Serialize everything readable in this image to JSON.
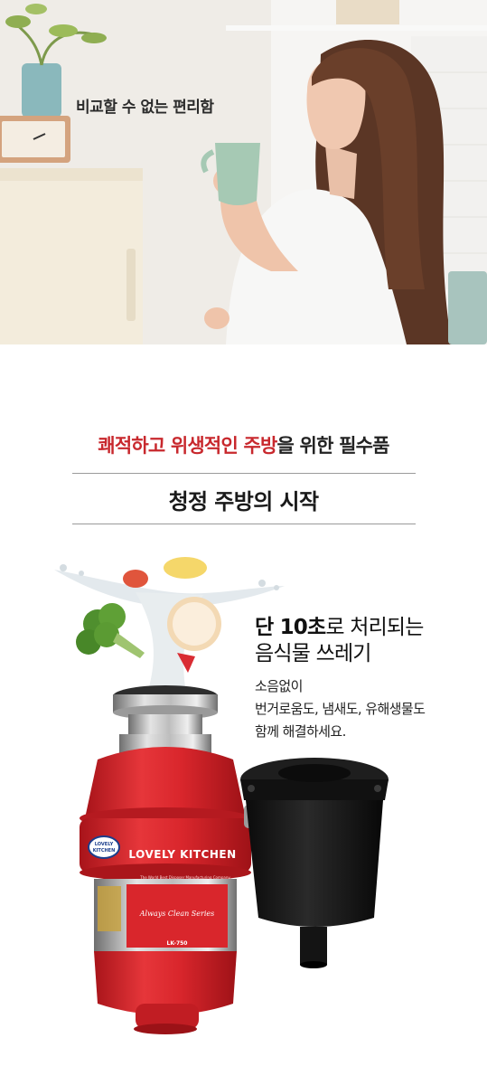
{
  "hero": {
    "caption": "비교할 수 없는 편리함"
  },
  "section": {
    "subtitle_accent_1": "쾌적하고 위생적인 주방",
    "subtitle_mid": "을 위한 필수품",
    "title": "청정 주방의 시작"
  },
  "feature": {
    "head_bold": "단 10초",
    "head_rest_1": "로 처리되는",
    "head_line_2": "음식물 쓰레기",
    "body_lines": [
      "소음없이",
      "번거로움도, 냄새도, 유해생물도",
      "함께 해결하세요."
    ]
  },
  "product": {
    "brand_text": "LOVELY KITCHEN",
    "badge_text": "LOVELY KITCHEN",
    "series_label": "Always Clean Series",
    "model": "LK-750",
    "tagline": "The World Best Disposer Manufacturing Company"
  },
  "colors": {
    "accent_red": "#c8282d",
    "disposer_red": "#d9262c",
    "hopper_black": "#151515"
  }
}
